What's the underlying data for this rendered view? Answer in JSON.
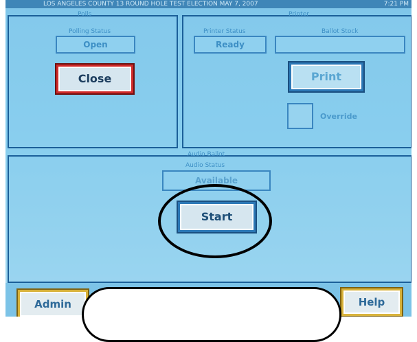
{
  "titlebar": {
    "title": "LOS ANGELES COUNTY  13 ROUND HOLE TEST ELECTION  MAY 7, 2007",
    "time": "7:21 PM"
  },
  "polls_panel": {
    "legend": "Polls",
    "status_caption": "Polling Status",
    "status_value": "Open",
    "close_label": "Close"
  },
  "printer_panel": {
    "legend": "Printer",
    "status_caption": "Printer Status",
    "status_value": "Ready",
    "ballot_caption": "Ballot Stock",
    "ballot_value": "",
    "print_label": "Print",
    "override_label": "Override"
  },
  "audio_panel": {
    "legend": "Audio Ballot",
    "status_caption": "Audio Status",
    "status_value": "Available",
    "start_label": "Start"
  },
  "bottom": {
    "admin_label": "Admin",
    "help_label": "Help"
  },
  "colors": {
    "screen": "#86cdee",
    "panel_border": "#1b5f99",
    "close_ring": "#d02a2a",
    "admin_help_ring": "#d8b23a"
  }
}
